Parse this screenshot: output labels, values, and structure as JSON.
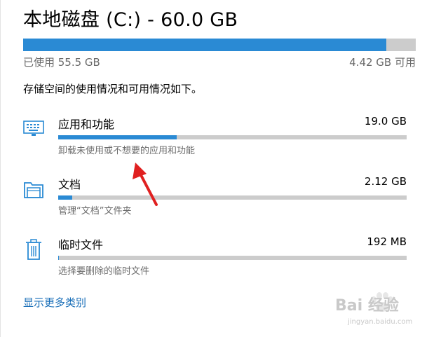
{
  "header": {
    "title": "本地磁盘 (C:) - 60.0 GB",
    "used_label": "已使用 55.5 GB",
    "free_label": "4.42 GB 可用",
    "used_fraction": 0.925
  },
  "description": "存储空间的使用情况和可用情况如下。",
  "categories": [
    {
      "name": "应用和功能",
      "size": "19.0 GB",
      "subtitle": "卸载未使用或不想要的应用和功能",
      "fraction": 0.34,
      "icon": "keyboard-icon"
    },
    {
      "name": "文档",
      "size": "2.12 GB",
      "subtitle": "管理“文档”文件夹",
      "fraction": 0.04,
      "icon": "folder-icon"
    },
    {
      "name": "临时文件",
      "size": "192 MB",
      "subtitle": "选择要删除的临时文件",
      "fraction": 0.003,
      "icon": "trash-icon"
    }
  ],
  "more_link": "显示更多类别",
  "watermark": {
    "text": "Bai 经验",
    "url": "jingyan.baidu.com"
  },
  "colors": {
    "accent": "#2a8ad4",
    "track": "#cccccc",
    "link": "#1a6fb8",
    "annotation": "#e02020"
  }
}
